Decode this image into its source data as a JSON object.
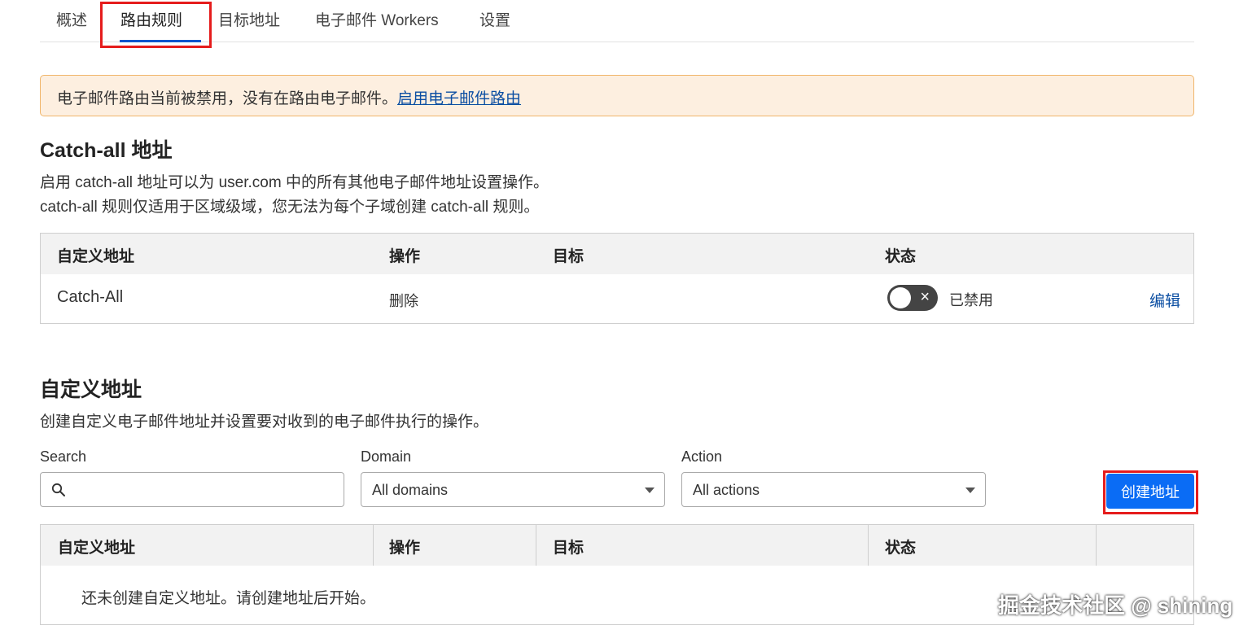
{
  "tabs": [
    {
      "label": "概述"
    },
    {
      "label": "路由规则"
    },
    {
      "label": "目标地址"
    },
    {
      "label": "电子邮件 Workers"
    },
    {
      "label": "设置"
    }
  ],
  "banner": {
    "text": "电子邮件路由当前被禁用，没有在路由电子邮件。",
    "link": "启用电子邮件路由"
  },
  "catchall": {
    "title": "Catch-all 地址",
    "desc_line1": "启用 catch-all 地址可以为 user.com 中的所有其他电子邮件地址设置操作。",
    "desc_line2": "catch-all 规则仅适用于区域级域，您无法为每个子域创建 catch-all 规则。",
    "headers": [
      "自定义地址",
      "操作",
      "目标",
      "状态"
    ],
    "row": {
      "address": "Catch-All",
      "action": "删除",
      "target": "",
      "status": "已禁用",
      "edit": "编辑",
      "enabled": false
    }
  },
  "custom": {
    "title": "自定义地址",
    "desc": "创建自定义电子邮件地址并设置要对收到的电子邮件执行的操作。",
    "filters": {
      "search_label": "Search",
      "search_value": "",
      "domain_label": "Domain",
      "domain_value": "All domains",
      "action_label": "Action",
      "action_value": "All actions"
    },
    "create_button": "创建地址",
    "headers": [
      "自定义地址",
      "操作",
      "目标",
      "状态"
    ],
    "empty_text": "还未创建自定义地址。请创建地址后开始。"
  },
  "watermark": "掘金技术社区 @ shining",
  "colors": {
    "accent": "#0a6cf5",
    "link": "#0b4ea2",
    "highlight": "#e51c1c",
    "banner_bg": "#fdefe0",
    "banner_border": "#f0b56a"
  }
}
